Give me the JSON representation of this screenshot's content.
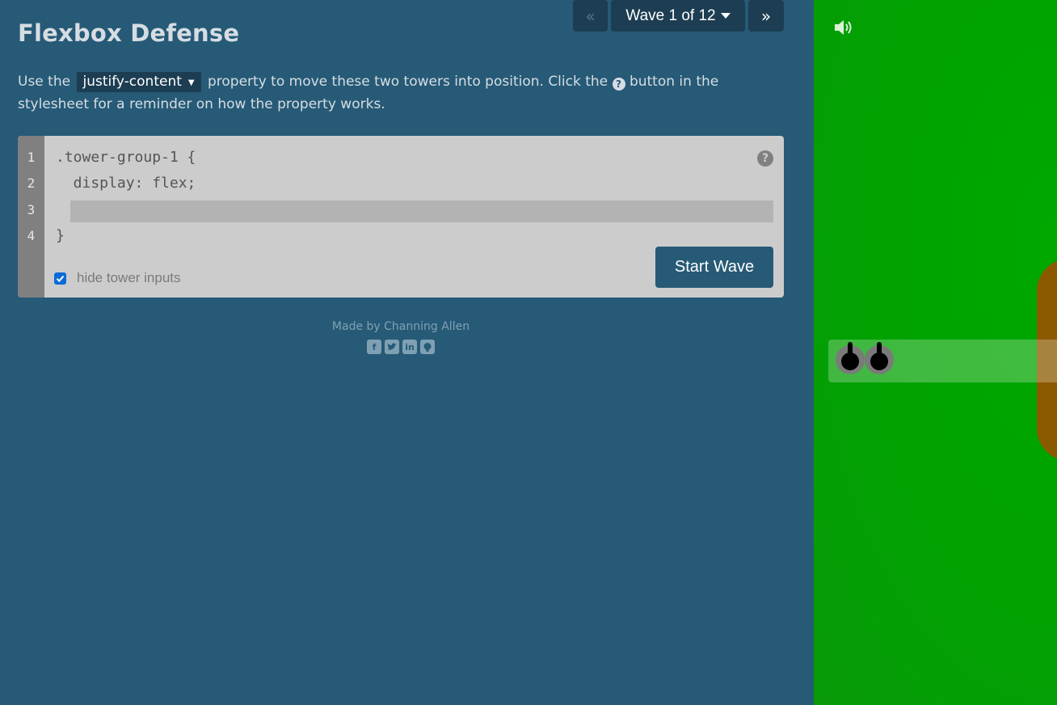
{
  "header": {
    "title": "Flexbox Defense",
    "prev_label": "«",
    "wave_label": "Wave 1 of 12",
    "next_label": "»"
  },
  "instructions": {
    "part1": "Use the",
    "property": "justify-content",
    "part2": "property to move these two towers into position. Click the",
    "help_glyph": "?",
    "part3": "button in the stylesheet for a reminder on how the property works."
  },
  "editor": {
    "line_numbers": [
      "1",
      "2",
      "3",
      "4"
    ],
    "line1": ".tower-group-1 {",
    "line2": "  display: flex;",
    "line3_value": "",
    "line4": "}",
    "help_glyph": "?",
    "start_button": "Start Wave",
    "hide_inputs_label": "hide tower inputs",
    "hide_inputs_checked": true
  },
  "footer": {
    "credit": "Made by Channing Allen",
    "social_icons": [
      "facebook-icon",
      "twitter-icon",
      "linkedin-icon",
      "github-icon"
    ]
  },
  "game": {
    "sound_icon": "speaker-icon",
    "tower_count": 2,
    "colors": {
      "grass": "#00a300",
      "path": "#8b5a00",
      "tower_base": "#7a7a7a"
    }
  },
  "colors": {
    "background": "#265a77",
    "button_dark": "#1c3d52",
    "editor_bg": "#cccccc",
    "gutter": "#808080"
  }
}
